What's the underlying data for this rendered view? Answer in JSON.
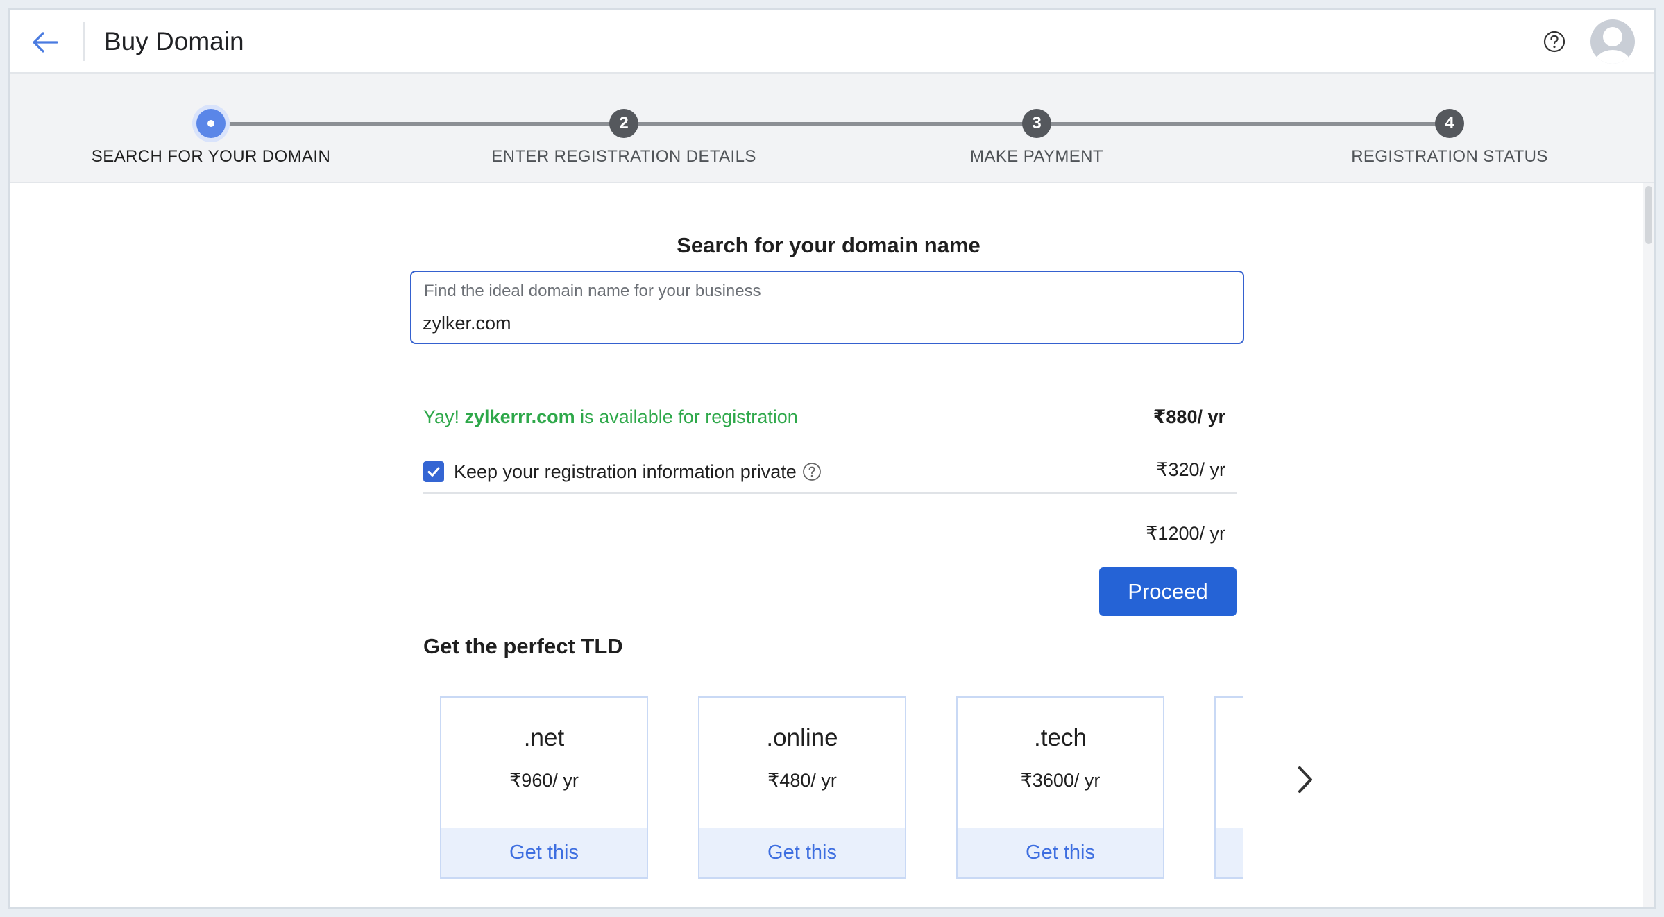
{
  "header": {
    "title": "Buy Domain"
  },
  "steps": [
    {
      "number": "",
      "label": "SEARCH FOR YOUR DOMAIN",
      "state": "active"
    },
    {
      "number": "2",
      "label": "ENTER REGISTRATION DETAILS",
      "state": "pending"
    },
    {
      "number": "3",
      "label": "MAKE PAYMENT",
      "state": "pending"
    },
    {
      "number": "4",
      "label": "REGISTRATION STATUS",
      "state": "pending"
    }
  ],
  "search": {
    "title": "Search for your domain name",
    "placeholder": "Find the ideal domain name for your business",
    "value": "zylker.com"
  },
  "availability": {
    "prefix": "Yay! ",
    "domain": "zylkerrr.com",
    "suffix": " is available for registration",
    "price": "₹880/ yr"
  },
  "privacy": {
    "label": "Keep your registration information private",
    "checked": true,
    "price": "₹320/ yr"
  },
  "total": {
    "price": "₹1200/ yr"
  },
  "proceed": {
    "label": "Proceed"
  },
  "tld": {
    "title": "Get the perfect TLD",
    "cards": [
      {
        "name": ".net",
        "price": "₹960/ yr",
        "action": "Get this"
      },
      {
        "name": ".online",
        "price": "₹480/ yr",
        "action": "Get this"
      },
      {
        "name": ".tech",
        "price": "₹3600/ yr",
        "action": "Get this"
      },
      {
        "name": "",
        "price": "",
        "action": ""
      }
    ]
  },
  "colors": {
    "primary": "#2563d6",
    "available_green": "#2ea84a",
    "step_active": "#5a86e8",
    "step_pending": "#55585d"
  },
  "icons": {
    "back": "arrow-left-icon",
    "help": "question-circle-icon",
    "avatar": "user-avatar-icon",
    "checkbox": "check-icon",
    "info": "question-circle-icon",
    "next": "chevron-right-icon"
  }
}
